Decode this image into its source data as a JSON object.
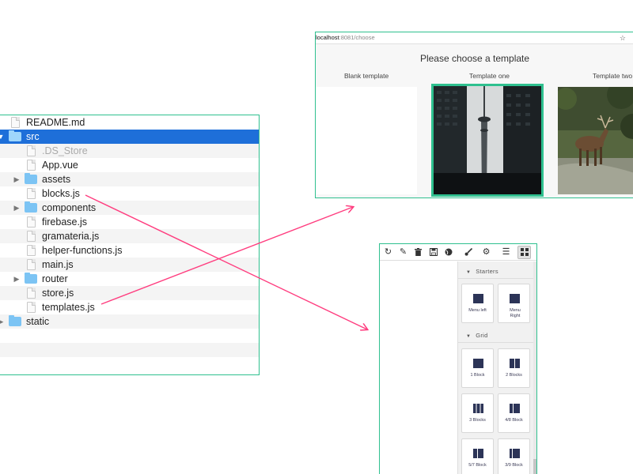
{
  "file_tree": {
    "items": [
      {
        "label": "README.md",
        "type": "file",
        "depth": 0,
        "alt": false,
        "selected": false,
        "dim": false,
        "expander": ""
      },
      {
        "label": "src",
        "type": "folder",
        "depth": 0,
        "alt": false,
        "selected": true,
        "dim": false,
        "expander": "▼"
      },
      {
        "label": ".DS_Store",
        "type": "file",
        "depth": 1,
        "alt": true,
        "selected": false,
        "dim": true,
        "expander": ""
      },
      {
        "label": "App.vue",
        "type": "file",
        "depth": 1,
        "alt": false,
        "selected": false,
        "dim": false,
        "expander": ""
      },
      {
        "label": "assets",
        "type": "folder",
        "depth": 1,
        "alt": true,
        "selected": false,
        "dim": false,
        "expander": "▶"
      },
      {
        "label": "blocks.js",
        "type": "file",
        "depth": 1,
        "alt": false,
        "selected": false,
        "dim": false,
        "expander": ""
      },
      {
        "label": "components",
        "type": "folder",
        "depth": 1,
        "alt": true,
        "selected": false,
        "dim": false,
        "expander": "▶"
      },
      {
        "label": "firebase.js",
        "type": "file",
        "depth": 1,
        "alt": false,
        "selected": false,
        "dim": false,
        "expander": ""
      },
      {
        "label": "gramateria.js",
        "type": "file",
        "depth": 1,
        "alt": true,
        "selected": false,
        "dim": false,
        "expander": ""
      },
      {
        "label": "helper-functions.js",
        "type": "file",
        "depth": 1,
        "alt": false,
        "selected": false,
        "dim": false,
        "expander": ""
      },
      {
        "label": "main.js",
        "type": "file",
        "depth": 1,
        "alt": true,
        "selected": false,
        "dim": false,
        "expander": ""
      },
      {
        "label": "router",
        "type": "folder",
        "depth": 1,
        "alt": false,
        "selected": false,
        "dim": false,
        "expander": "▶"
      },
      {
        "label": "store.js",
        "type": "file",
        "depth": 1,
        "alt": true,
        "selected": false,
        "dim": false,
        "expander": ""
      },
      {
        "label": "templates.js",
        "type": "file",
        "depth": 1,
        "alt": false,
        "selected": false,
        "dim": false,
        "expander": ""
      },
      {
        "label": "static",
        "type": "folder",
        "depth": 0,
        "alt": true,
        "selected": false,
        "dim": false,
        "expander": "▶"
      },
      {
        "label": "",
        "type": "empty",
        "depth": 0,
        "alt": false,
        "selected": false,
        "dim": false,
        "expander": ""
      },
      {
        "label": "",
        "type": "empty",
        "depth": 0,
        "alt": true,
        "selected": false,
        "dim": false,
        "expander": ""
      },
      {
        "label": "",
        "type": "empty",
        "depth": 0,
        "alt": false,
        "selected": false,
        "dim": false,
        "expander": ""
      }
    ]
  },
  "browser": {
    "url_host": "localhost",
    "url_path": ":8081/choose",
    "title": "Please choose a template",
    "templates": {
      "blank": "Blank template",
      "one": "Template one",
      "two": "Template two"
    }
  },
  "builder": {
    "toolbar": {
      "refresh": "↻",
      "edit": "✎",
      "delete": "🗑",
      "save": "💾",
      "preview": "◕",
      "style": "🖌",
      "settings": "⚙",
      "layers": "☰",
      "blocks": "▦"
    },
    "sections": {
      "starters": "Starters",
      "grid": "Grid"
    },
    "starter_blocks": [
      "Menu left",
      "Menu Right"
    ],
    "grid_blocks": [
      "1 Block",
      "2 Blocks",
      "3 Blocks",
      "4/8 Block",
      "5/7 Block",
      "3/9 Block"
    ]
  },
  "colors": {
    "border_accent": "#2fc08f",
    "selection": "#1e6fd9",
    "folder": "#7cc4f4",
    "arrow": "#ff3d7f",
    "block_glyph": "#2c3457"
  }
}
